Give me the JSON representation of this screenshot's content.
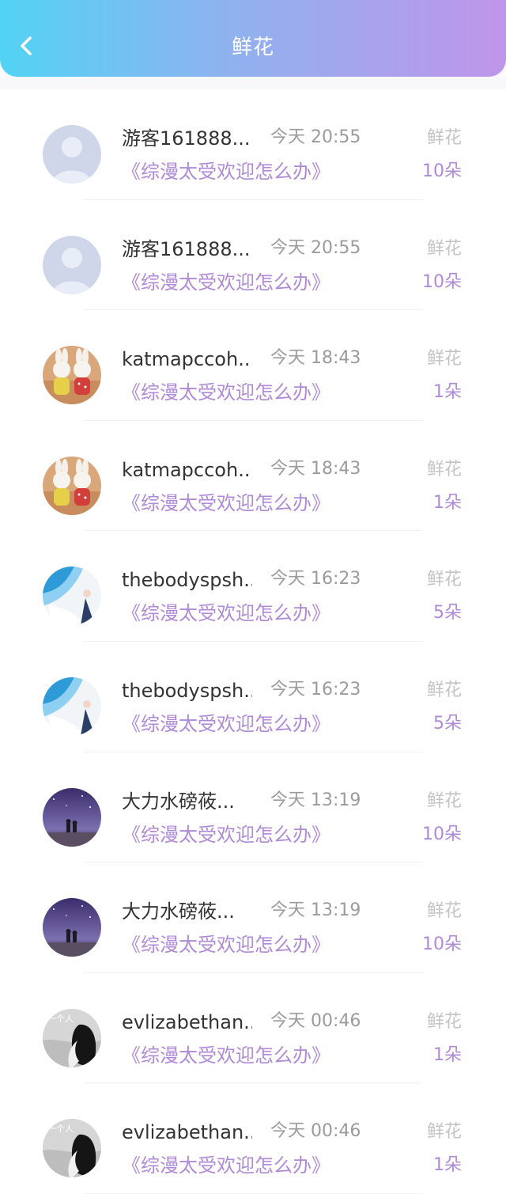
{
  "header": {
    "title": "鲜花",
    "back_icon": "chevron-left-icon",
    "gradient": [
      "#52d3f5",
      "#bf95ea"
    ]
  },
  "list": {
    "items": [
      {
        "avatar": "default-user-avatar",
        "name": "游客161888...",
        "time": "今天 20:55",
        "book": "《综漫太受欢迎怎么办》",
        "gift_label": "鲜花",
        "gift_count": "10朵"
      },
      {
        "avatar": "default-user-avatar",
        "name": "游客161888...",
        "time": "今天 20:55",
        "book": "《综漫太受欢迎怎么办》",
        "gift_label": "鲜花",
        "gift_count": "10朵"
      },
      {
        "avatar": "rabbit-toys-avatar",
        "name": "katmapccoh...",
        "time": "今天 18:43",
        "book": "《综漫太受欢迎怎么办》",
        "gift_label": "鲜花",
        "gift_count": "1朵"
      },
      {
        "avatar": "rabbit-toys-avatar",
        "name": "katmapccoh...",
        "time": "今天 18:43",
        "book": "《综漫太受欢迎怎么办》",
        "gift_label": "鲜花",
        "gift_count": "1朵"
      },
      {
        "avatar": "blue-sky-girl-avatar",
        "name": "thebodyspsh...",
        "time": "今天 16:23",
        "book": "《综漫太受欢迎怎么办》",
        "gift_label": "鲜花",
        "gift_count": "5朵"
      },
      {
        "avatar": "blue-sky-girl-avatar",
        "name": "thebodyspsh...",
        "time": "今天 16:23",
        "book": "《综漫太受欢迎怎么办》",
        "gift_label": "鲜花",
        "gift_count": "5朵"
      },
      {
        "avatar": "night-sky-avatar",
        "name": "大力水磅莜...",
        "time": "今天 13:19",
        "book": "《综漫太受欢迎怎么办》",
        "gift_label": "鲜花",
        "gift_count": "10朵"
      },
      {
        "avatar": "night-sky-avatar",
        "name": "大力水磅莜...",
        "time": "今天 13:19",
        "book": "《综漫太受欢迎怎么办》",
        "gift_label": "鲜花",
        "gift_count": "10朵"
      },
      {
        "avatar": "girl-silhouette-avatar",
        "avatar_text": "一个人",
        "name": "evlizabethan...",
        "time": "今天 00:46",
        "book": "《综漫太受欢迎怎么办》",
        "gift_label": "鲜花",
        "gift_count": "1朵"
      },
      {
        "avatar": "girl-silhouette-avatar",
        "avatar_text": "一个人",
        "name": "evlizabethan...",
        "time": "今天 00:46",
        "book": "《综漫太受欢迎怎么办》",
        "gift_label": "鲜花",
        "gift_count": "1朵"
      }
    ]
  }
}
